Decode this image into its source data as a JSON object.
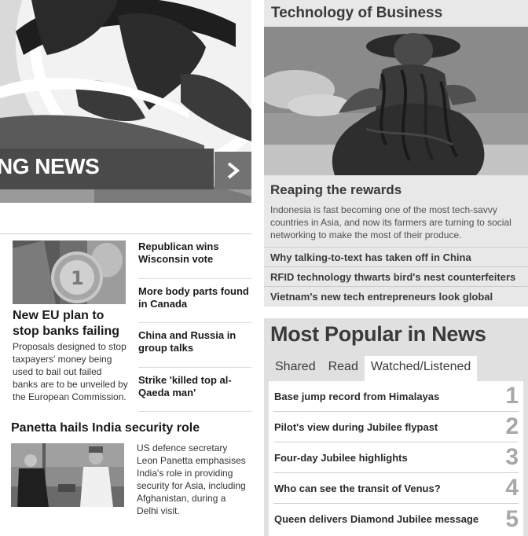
{
  "banner": {
    "text": "NG NEWS",
    "arrow_icon": "chevron-right-icon"
  },
  "feature": {
    "title": "New EU plan to stop banks failing",
    "summary": "Proposals designed to stop taxpayers' money being used to bail out failed banks are to be unveiled by the European Commission."
  },
  "headlines": [
    "Republican wins Wisconsin vote",
    "More body parts found in Canada",
    "China and Russia in group talks",
    "Strike 'killed top al-Qaeda man'"
  ],
  "panetta": {
    "title": "Panetta hails India security role",
    "summary": "US defence secretary Leon Panetta emphasises India's role in providing security for Asia, including Afghanistan, during a Delhi visit."
  },
  "tech_of_business": {
    "heading": "Technology of Business",
    "feature_title": "Reaping the rewards",
    "feature_summary": "Indonesia is fast becoming one of the most tech-savvy countries in Asia, and now its farmers are turning to social networking to make the most of their produce.",
    "links": [
      "Why talking-to-text has taken off in China",
      "RFID technology thwarts bird's nest counterfeiters",
      "Vietnam's new tech entrepreneurs look global"
    ]
  },
  "most_popular": {
    "heading": "Most Popular in News",
    "tabs": [
      "Shared",
      "Read",
      "Watched/Listened"
    ],
    "active_tab": "Watched/Listened",
    "items": [
      {
        "title": "Base jump record from Himalayas",
        "rank": "1"
      },
      {
        "title": "Pilot's view during Jubilee flypast",
        "rank": "2"
      },
      {
        "title": "Four-day Jubilee highlights",
        "rank": "3"
      },
      {
        "title": "Who can see the transit of Venus?",
        "rank": "4"
      },
      {
        "title": "Queen delivers Diamond Jubilee message",
        "rank": "5"
      }
    ]
  }
}
